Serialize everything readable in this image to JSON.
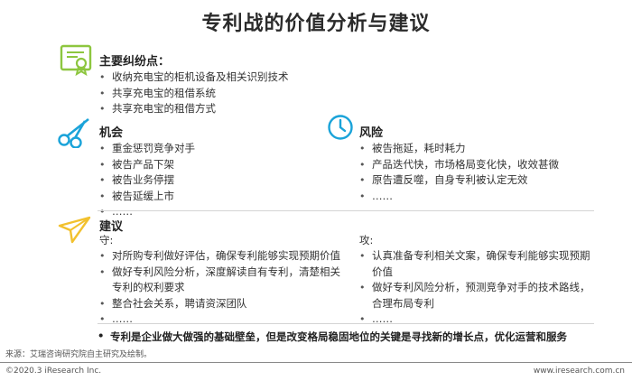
{
  "title": "专利战的价值分析与建议",
  "colors": {
    "accent_green": "#8dc63f",
    "accent_blue": "#1aa3d9",
    "accent_yellow": "#f2c12e"
  },
  "disputes": {
    "icon": "certificate-icon",
    "heading": "主要纠纷点：",
    "items": [
      "收纳充电宝的柜机设备及相关识别技术",
      "共享充电宝的租借系统",
      "共享充电宝的租借方式"
    ]
  },
  "opportunity": {
    "icon": "scissors-icon",
    "heading": "机会",
    "items": [
      "重金惩罚竞争对手",
      "被告产品下架",
      "被告业务停摆",
      "被告延缓上市",
      "……"
    ]
  },
  "risk": {
    "icon": "clock-icon",
    "heading": "风险",
    "items": [
      "被告拖延，耗时耗力",
      "产品迭代快，市场格局变化快，收效甚微",
      "原告遭反噬，自身专利被认定无效",
      "……"
    ]
  },
  "advice": {
    "icon": "paper-plane-icon",
    "heading": "建议",
    "defense": {
      "label": "守:",
      "items": [
        "对所购专利做好评估，确保专利能够实现预期价值",
        "做好专利风险分析，深度解读自有专利，清楚相关专利的权利要求",
        "整合社会关系，聘请资深团队",
        "……"
      ]
    },
    "offense": {
      "label": "攻:",
      "items": [
        "认真准备专利相关文案，确保专利能够实现预期价值",
        "做好专利风险分析，预测竞争对手的技术路线，合理布局专利",
        "……"
      ]
    }
  },
  "conclusion": "专利是企业做大做强的基础壁垒，但是改变格局稳固地位的关键是寻找新的增长点，优化运营和服务",
  "source": "来源：艾瑞咨询研究院自主研究及绘制。",
  "footer": {
    "left": "©2020.3 iResearch Inc.",
    "right": "www.iresearch.com.cn"
  }
}
